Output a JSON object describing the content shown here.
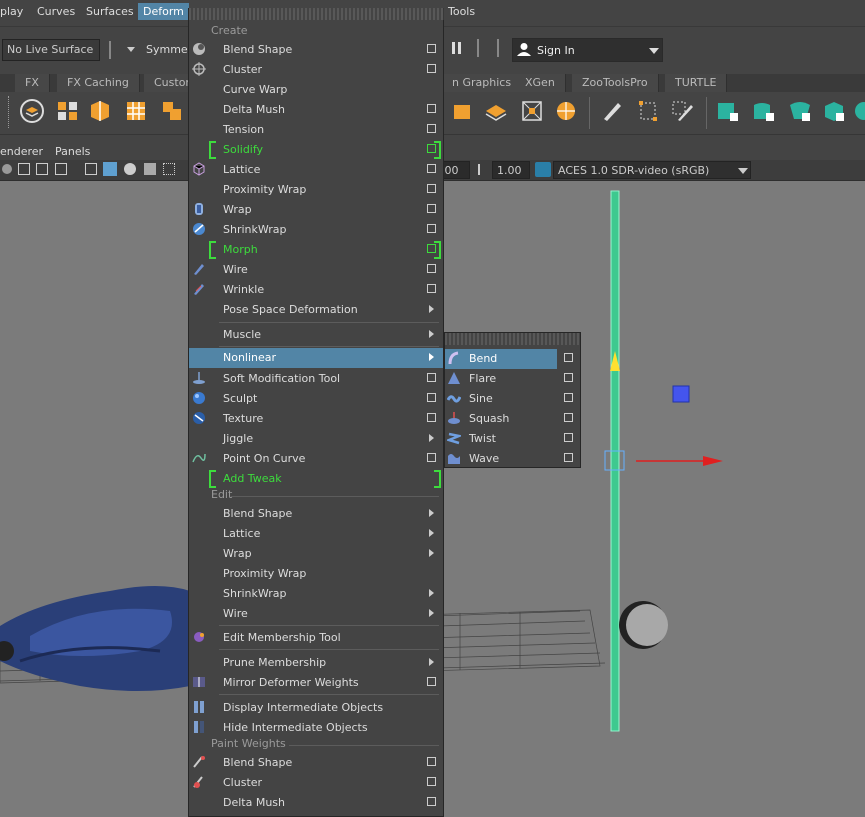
{
  "menubar": {
    "items": [
      "play",
      "Curves",
      "Surfaces",
      "Deform",
      "Tools"
    ]
  },
  "statusline": {
    "live_surface": "No Live Surface",
    "symmetry": "Symmetr",
    "sign_in": "Sign In"
  },
  "shelf_tabs": [
    "FX",
    "FX Caching",
    "Custor",
    "n Graphics",
    "XGen",
    "ZooToolsPro",
    "TURTLE"
  ],
  "panel_menu": [
    "enderer",
    "Panels"
  ],
  "panel_toolbar": {
    "value_a": ".00",
    "value_b": "1.00",
    "colorspace": "ACES 1.0 SDR-video (sRGB)"
  },
  "deform_menu": {
    "create_header": "Create",
    "create_items": [
      {
        "label": "Blend Shape",
        "option": true,
        "green": false,
        "arrow": false,
        "icon": "blend-shape-icon"
      },
      {
        "label": "Cluster",
        "option": true,
        "green": false,
        "arrow": false,
        "icon": "cluster-icon"
      },
      {
        "label": "Curve Warp",
        "option": false,
        "green": false,
        "arrow": false,
        "icon": ""
      },
      {
        "label": "Delta Mush",
        "option": true,
        "green": false,
        "arrow": false,
        "icon": ""
      },
      {
        "label": "Tension",
        "option": true,
        "green": false,
        "arrow": false,
        "icon": ""
      },
      {
        "label": "Solidify",
        "option": true,
        "green": true,
        "arrow": false,
        "icon": ""
      },
      {
        "label": "Lattice",
        "option": true,
        "green": false,
        "arrow": false,
        "icon": "lattice-icon"
      },
      {
        "label": "Proximity Wrap",
        "option": true,
        "green": false,
        "arrow": false,
        "icon": ""
      },
      {
        "label": "Wrap",
        "option": true,
        "green": false,
        "arrow": false,
        "icon": "wrap-icon"
      },
      {
        "label": "ShrinkWrap",
        "option": true,
        "green": false,
        "arrow": false,
        "icon": "shrinkwrap-icon"
      },
      {
        "label": "Morph",
        "option": true,
        "green": true,
        "arrow": false,
        "icon": ""
      },
      {
        "label": "Wire",
        "option": true,
        "green": false,
        "arrow": false,
        "icon": "wire-icon"
      },
      {
        "label": "Wrinkle",
        "option": true,
        "green": false,
        "arrow": false,
        "icon": "wrinkle-icon"
      },
      {
        "label": "Pose Space Deformation",
        "option": false,
        "green": false,
        "arrow": true,
        "icon": ""
      }
    ],
    "muscle": "Muscle",
    "nonlinear": "Nonlinear",
    "more_items": [
      {
        "label": "Soft Modification Tool",
        "option": true,
        "arrow": false,
        "icon": "soft-mod-icon"
      },
      {
        "label": "Sculpt",
        "option": true,
        "arrow": false,
        "icon": "sculpt-icon"
      },
      {
        "label": "Texture",
        "option": true,
        "arrow": false,
        "icon": "texture-icon"
      },
      {
        "label": "Jiggle",
        "option": false,
        "arrow": true,
        "icon": ""
      },
      {
        "label": "Point On Curve",
        "option": true,
        "arrow": false,
        "icon": "point-on-curve-icon"
      }
    ],
    "add_tweak": "Add Tweak",
    "edit_header": "Edit",
    "edit_items": [
      {
        "label": "Blend Shape",
        "arrow": true
      },
      {
        "label": "Lattice",
        "arrow": true
      },
      {
        "label": "Wrap",
        "arrow": true
      },
      {
        "label": "Proximity Wrap",
        "arrow": false
      },
      {
        "label": "ShrinkWrap",
        "arrow": true
      },
      {
        "label": "Wire",
        "arrow": true
      }
    ],
    "edit_membership": "Edit Membership Tool",
    "prune_membership": "Prune Membership",
    "mirror_weights": "Mirror Deformer Weights",
    "display_intermediate": "Display Intermediate Objects",
    "hide_intermediate": "Hide Intermediate Objects",
    "paint_header": "Paint Weights",
    "paint_items": [
      "Blend Shape",
      "Cluster",
      "Delta Mush"
    ]
  },
  "nonlinear_submenu": [
    {
      "label": "Bend",
      "icon": "bend-icon"
    },
    {
      "label": "Flare",
      "icon": "flare-icon"
    },
    {
      "label": "Sine",
      "icon": "sine-icon"
    },
    {
      "label": "Squash",
      "icon": "squash-icon"
    },
    {
      "label": "Twist",
      "icon": "twist-icon"
    },
    {
      "label": "Wave",
      "icon": "wave-icon"
    }
  ],
  "colors": {
    "highlight": "#5285a6",
    "green": "#3ddc3d",
    "menu_bg": "#444444"
  }
}
